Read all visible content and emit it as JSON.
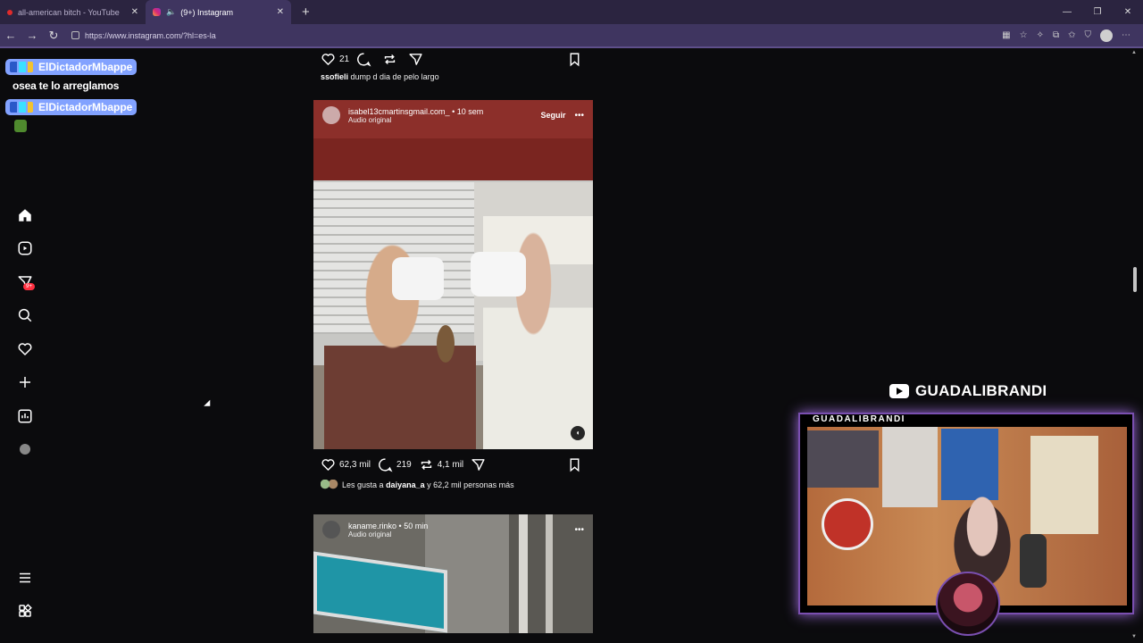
{
  "browser": {
    "tabs": [
      {
        "title": "all-american bitch - YouTube",
        "active": false
      },
      {
        "title": "(9+) Instagram",
        "active": true
      }
    ],
    "url": "https://www.instagram.com/?hl=es-la"
  },
  "chat": {
    "user1": "ElDictadorMbappe",
    "message1": "osea te lo arreglamos",
    "user2": "ElDictadorMbappe"
  },
  "nav": {
    "notif_badge": "9+"
  },
  "prev_post": {
    "likes": "21",
    "caption_user": "ssofieli",
    "caption_text": "dump d dia de pelo largo"
  },
  "post1": {
    "username": "isabel13cmartinsgmail.com_",
    "time": "• 10 sem",
    "audio": "Audio original",
    "follow": "Seguir",
    "likes": "62,3 mil",
    "comments": "219",
    "shares": "4,1 mil",
    "liked_prefix": "Les gusta a",
    "liked_user": "daiyana_a",
    "liked_suffix": "y 62,2 mil personas más"
  },
  "post2": {
    "username": "kaname.rinko",
    "time": "• 50 min",
    "audio": "Audio original"
  },
  "stream": {
    "yt_name": "GUADALIBRANDI",
    "cam_title": "GUADALIBRANDI"
  },
  "colors": {
    "accent": "#82a2ff",
    "notification": "#ff3040",
    "frame": "#7a4fb0"
  }
}
